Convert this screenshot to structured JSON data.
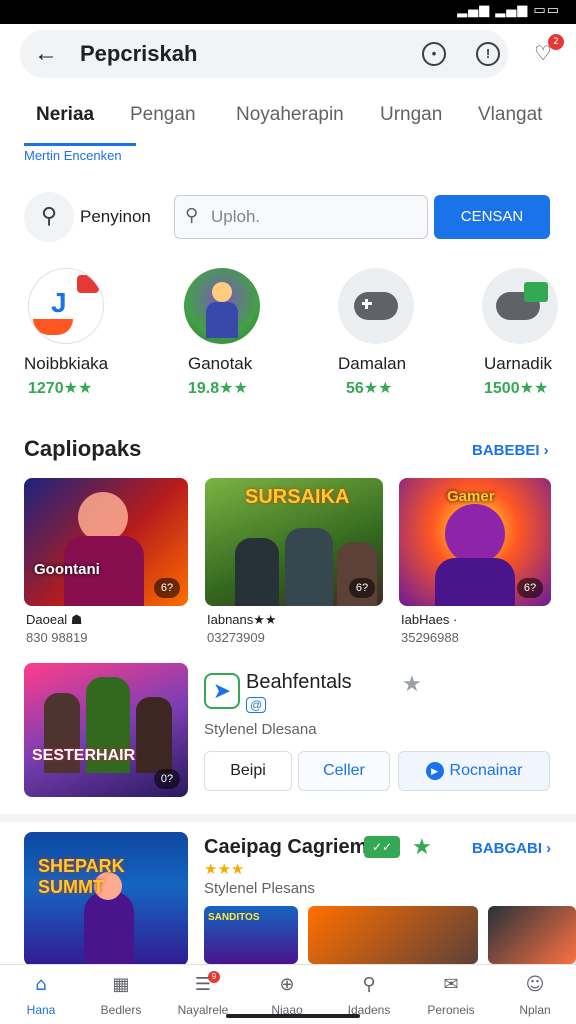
{
  "status_bar": {
    "icons": "▂▄▆ ▂▄▆ ▭▭"
  },
  "header": {
    "title": "Pepcriskah",
    "back_icon": "arrow-left-icon",
    "icons": [
      "target-icon",
      "info-icon",
      "bell-icon"
    ],
    "bell_badge": "2"
  },
  "tabs": {
    "items": [
      {
        "label": "Neriaa",
        "active": true
      },
      {
        "label": "Pengan",
        "active": false
      },
      {
        "label": "Noyaherapin",
        "active": false
      },
      {
        "label": "Urngan",
        "active": false
      },
      {
        "label": "Vlangat",
        "active": false
      }
    ],
    "sub_label": "Mertin Encenken"
  },
  "search": {
    "label": "Penyinon",
    "placeholder": "Uploh.",
    "button": "CENSAN"
  },
  "featured_apps": [
    {
      "name": "Noibbkiaka",
      "rating": "1270★★"
    },
    {
      "name": "Ganotak",
      "rating": "19.8★★"
    },
    {
      "name": "Damalan",
      "rating": "56★★"
    },
    {
      "name": "Uarnadik",
      "rating": "1500★★"
    }
  ],
  "section1": {
    "title": "Capliopaks",
    "link": "BABEBEI ›"
  },
  "cards": [
    {
      "thumb_label": "Goontani",
      "badge": "6?",
      "name": "Daoeal ☗",
      "num": "830 98819"
    },
    {
      "thumb_label": "SURSAIKA",
      "badge": "6?",
      "name": "Iabnans★★",
      "num": "03273909"
    },
    {
      "thumb_label": "Gamer",
      "badge": "6?",
      "name": "IabHaes ·",
      "num": "35296988"
    }
  ],
  "featured_item": {
    "thumb_label": "SESTERHAIR",
    "badge": "0?",
    "app_name": "Beahfentals",
    "small_badge": "@",
    "subtitle": "Stylenel Dlesana",
    "buttons": [
      "Beipi",
      "Celler",
      "Rocnainar"
    ]
  },
  "section2": {
    "thumb_label": "SHEPARK SUMMT",
    "title": "Caeipag Cagriem",
    "badge": "✓✓",
    "link": "BABGABI ›",
    "stars": "★★★",
    "subtitle": "Stylenel Plesans",
    "minis": [
      "SANDITOS",
      "",
      ""
    ]
  },
  "nav": [
    {
      "label": "Hana",
      "icon": "home-icon",
      "active": true
    },
    {
      "label": "Bedlers",
      "icon": "dashboard-icon",
      "active": false
    },
    {
      "label": "Nayalrele",
      "icon": "list-icon",
      "active": false,
      "badge": "9"
    },
    {
      "label": "Niaao",
      "icon": "compass-icon",
      "active": false
    },
    {
      "label": "Idadens",
      "icon": "search-icon",
      "active": false
    },
    {
      "label": "Peroneis",
      "icon": "mail-icon",
      "active": false
    },
    {
      "label": "Nplan",
      "icon": "person-icon",
      "active": false
    }
  ],
  "colors": {
    "accent": "#1a73e8",
    "rating_green": "#34a853",
    "badge_red": "#e53935",
    "star_yellow": "#f9ab00"
  }
}
